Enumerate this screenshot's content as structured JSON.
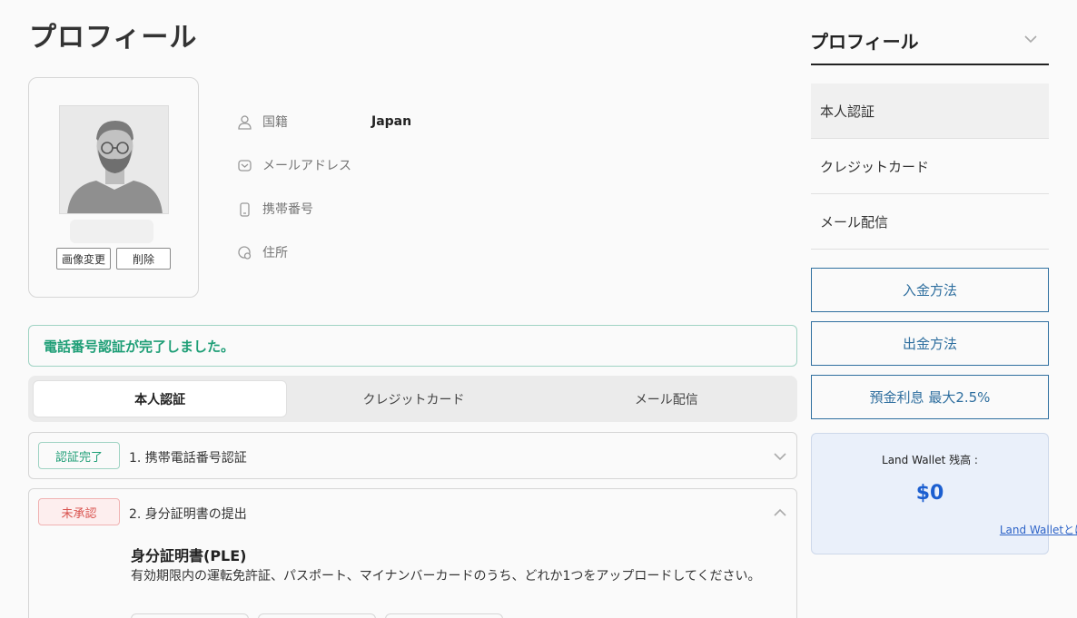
{
  "page_title": "プロフィール",
  "profile": {
    "change_image_label": "画像変更",
    "delete_label": "削除",
    "fields": [
      {
        "label": "国籍",
        "value": "Japan",
        "icon": "user-icon"
      },
      {
        "label": "メールアドレス",
        "value": "",
        "icon": "mail-icon"
      },
      {
        "label": "携帯番号",
        "value": "",
        "icon": "phone-icon"
      },
      {
        "label": "住所",
        "value": "",
        "icon": "location-icon"
      }
    ]
  },
  "alert_message": "電話番号認証が完了しました。",
  "tabs": [
    {
      "label": "本人認証",
      "active": true
    },
    {
      "label": "クレジットカード",
      "active": false
    },
    {
      "label": "メール配信",
      "active": false
    }
  ],
  "steps": [
    {
      "badge": "認証完了",
      "title": "1. 携帯電話番号認証",
      "expanded": false
    },
    {
      "badge": "未承認",
      "title": "2. 身分証明書の提出",
      "expanded": true,
      "doc_title": "身分証明書(PLE)",
      "doc_desc": "有効期限内の運転免許証、パスポート、マイナンバーカードのうち、どれか1つをアップロードしてください。"
    }
  ],
  "sidebar": {
    "title": "プロフィール",
    "items": [
      {
        "label": "本人認証",
        "active": true
      },
      {
        "label": "クレジットカード",
        "active": false
      },
      {
        "label": "メール配信",
        "active": false
      }
    ],
    "buttons": [
      {
        "label": "入金方法"
      },
      {
        "label": "出金方法"
      },
      {
        "label": "預金利息 最大2.5%"
      }
    ],
    "wallet": {
      "label": "Land Wallet 残高 :",
      "amount": "$0",
      "link": "Land Walletとは？"
    }
  },
  "colors": {
    "success": "#1e9e76",
    "danger": "#d9534f",
    "link_blue": "#2f6f9f",
    "wallet_amount": "#1c5fd0"
  }
}
